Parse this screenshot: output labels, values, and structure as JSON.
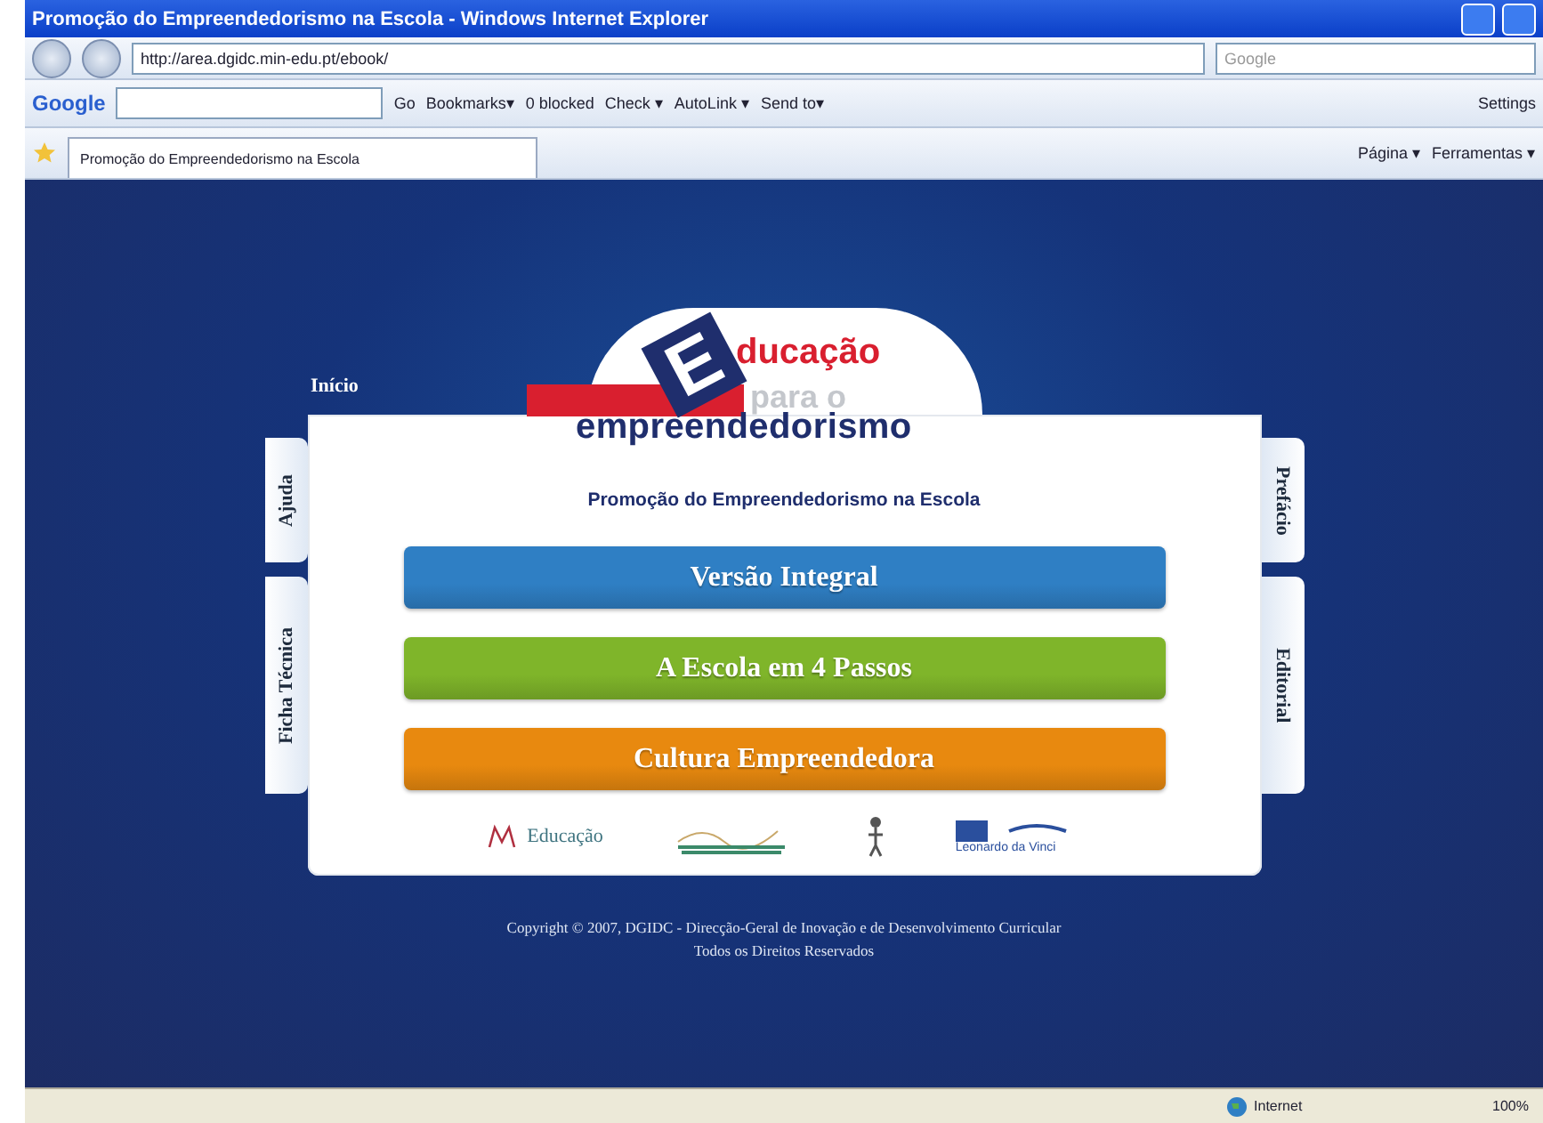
{
  "window": {
    "title": "Promoção do Empreendedorismo na Escola - Windows Internet Explorer"
  },
  "address_bar": {
    "url": "http://area.dgidc.min-edu.pt/ebook/",
    "search_placeholder": "Google"
  },
  "google_toolbar": {
    "brand": "Google",
    "items": [
      "Go",
      "Bookmarks▾",
      "0 blocked",
      "Check ▾",
      "AutoLink ▾",
      "Send to▾"
    ],
    "settings": "Settings"
  },
  "tab_bar": {
    "tabs": [
      {
        "label": "Promoção do Empreendedorismo na Escola",
        "selected": true
      }
    ],
    "commands": [
      "Página ▾",
      "Ferramentas ▾"
    ]
  },
  "page": {
    "home_link": "Início",
    "left_tabs": [
      "Ajuda",
      "Ficha Técnica"
    ],
    "right_tabs": [
      "Prefácio",
      "Editorial"
    ],
    "logo": {
      "initial": "E",
      "line_1": "ducação",
      "line_2": "para o",
      "line_3": "empreendedorismo"
    },
    "subtitle": "Promoção do Empreendedorismo na Escola",
    "menu": [
      {
        "label": "Versão Integral",
        "color": "#2f7fc4"
      },
      {
        "label": "A Escola em 4 Passos",
        "color": "#7fb52a"
      },
      {
        "label": "Cultura Empreendedora",
        "color": "#e8890f"
      }
    ],
    "partners": {
      "ministry": "Educação",
      "leonardo": "Leonardo da Vinci"
    },
    "copyright": [
      "Copyright © 2007, DGIDC - Direcção-Geral de Inovação e de Desenvolvimento Curricular",
      "Todos os Direitos Reservados"
    ]
  },
  "status_bar": {
    "zone": "Internet",
    "zoom": "100%"
  }
}
